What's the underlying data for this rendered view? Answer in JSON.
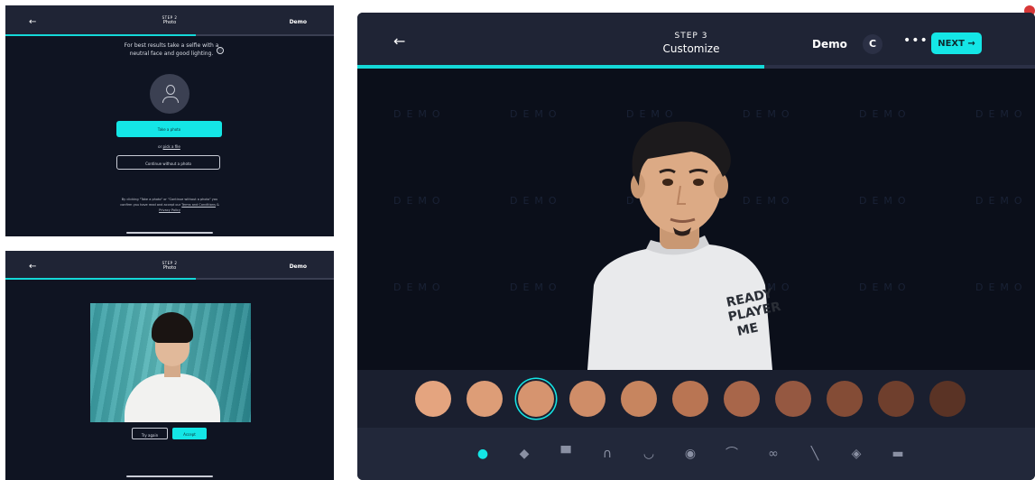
{
  "panels": {
    "photo_prompt": {
      "step_label": "STEP 2",
      "step_title": "Photo",
      "demo": "Demo",
      "instructions": "For best results take a selfie with a neutral face and good lighting.",
      "info_icon": "ⓘ",
      "take_photo_label": "Take a photo",
      "pick_prefix": "or",
      "pick_link": "pick a file",
      "continue_label": "Continue without a photo",
      "legal_text": "By clicking \"Take a photo\" or \"Continue without a photo\" you confirm you have read and accept our",
      "terms_link": "Terms and Conditions",
      "legal_and": "&",
      "privacy_link": "Privacy Policy"
    },
    "photo_review": {
      "step_label": "STEP 2",
      "step_title": "Photo",
      "demo": "Demo",
      "try_again_label": "Try again",
      "accept_label": "Accept"
    },
    "customize": {
      "step_label": "STEP 3",
      "step_title": "Customize",
      "demo": "Demo",
      "c_icon": "C",
      "dots": "•••",
      "next_label": "NEXT →",
      "progress": 0.6,
      "watermark": "DEMO",
      "shirt_text_1": "READY",
      "shirt_text_2": "PLAYER",
      "shirt_text_3": "ME",
      "swatches": [
        "#e4a47f",
        "#dd9d77",
        "#d6946f",
        "#cf8d68",
        "#c7855f",
        "#b97553",
        "#a8664a",
        "#955841",
        "#844c36",
        "#6f3f2d",
        "#5a3325"
      ],
      "selected_swatch": 2,
      "toolbar_icons": [
        "skin-icon",
        "shapes-icon",
        "shirt-icon",
        "hair-icon",
        "beard-icon",
        "eye-icon",
        "eyebrow-icon",
        "glasses-icon",
        "nose-icon",
        "mask-icon",
        "hat-icon"
      ]
    }
  },
  "progress": {
    "photo_prompt": 0.58,
    "photo_review": 0.58
  }
}
